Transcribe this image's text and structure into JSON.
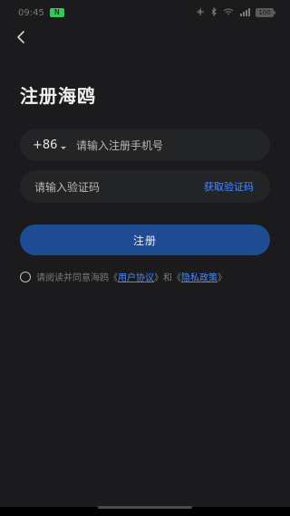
{
  "status_bar": {
    "time": "09:45",
    "badge": "N",
    "battery": "100"
  },
  "header": {
    "title": "注册海鸥"
  },
  "phone": {
    "country_code": "+86",
    "placeholder": "请输入注册手机号"
  },
  "code": {
    "placeholder": "请输入验证码",
    "get_code_label": "获取验证码"
  },
  "register_button": {
    "label": "注册"
  },
  "agreement": {
    "prefix": "请阅读并同意海鸥",
    "quote_open_1": "《",
    "user_agreement": "用户协议",
    "quote_close_1": "》",
    "and": "和",
    "quote_open_2": "《",
    "privacy_policy": "隐私政策",
    "quote_close_2": "》"
  },
  "colors": {
    "background": "#1b1b1d",
    "accent_link": "#4b89ff",
    "primary_button": "#1f4b92",
    "field_bg": "#232426"
  },
  "icons": {
    "back": "chevron-left-icon",
    "dropdown": "chevron-down-icon",
    "checkbox": "radio-circle-icon"
  }
}
